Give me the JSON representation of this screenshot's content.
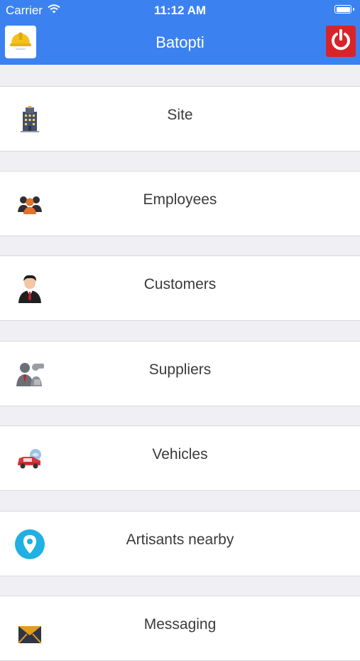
{
  "status_bar": {
    "carrier": "Carrier",
    "time": "11:12 AM"
  },
  "header": {
    "title": "Batopti"
  },
  "colors": {
    "header": "#3b82f0",
    "power": "#d9232a",
    "text": "#3a3a3a",
    "background": "#efeff4"
  },
  "menu": [
    {
      "label": "Site",
      "icon": "building-icon"
    },
    {
      "label": "Employees",
      "icon": "team-icon"
    },
    {
      "label": "Customers",
      "icon": "businessman-icon"
    },
    {
      "label": "Suppliers",
      "icon": "suppliers-icon"
    },
    {
      "label": "Vehicles",
      "icon": "car-icon"
    },
    {
      "label": "Artisants nearby",
      "icon": "location-pin-icon"
    },
    {
      "label": "Messaging",
      "icon": "envelope-icon"
    }
  ]
}
